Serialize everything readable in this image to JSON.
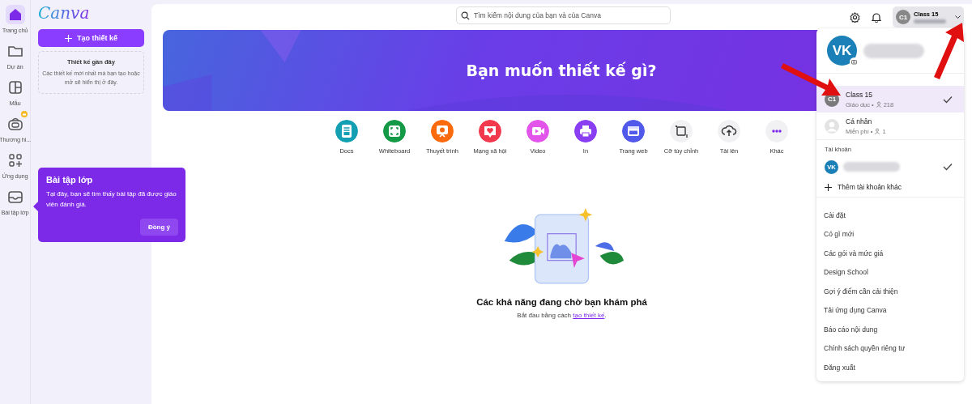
{
  "logo": "Canva",
  "rail": [
    {
      "label": "Trang chủ",
      "kind": "home",
      "selected": true,
      "badge": false
    },
    {
      "label": "Dự án",
      "kind": "folder",
      "selected": false,
      "badge": false
    },
    {
      "label": "Mẫu",
      "kind": "template",
      "selected": false,
      "badge": false
    },
    {
      "label": "Thương hi...",
      "kind": "brand",
      "selected": false,
      "badge": true
    },
    {
      "label": "Ứng dụng",
      "kind": "apps",
      "selected": false,
      "badge": false
    },
    {
      "label": "Bài tập lớp",
      "kind": "inbox",
      "selected": false,
      "badge": false
    }
  ],
  "create_button": "Tạo thiết kế",
  "recent": {
    "title": "Thiết kế gần đây",
    "text": "Các thiết kế mới nhất mà bạn tạo hoặc mở sẽ hiển thị ở đây."
  },
  "tooltip": {
    "title": "Bài tập lớp",
    "text": "Tại đây, bạn sẽ tìm thấy bài tập đã được giáo viên đánh giá.",
    "button": "Đồng ý"
  },
  "search": {
    "placeholder": "Tìm kiếm nội dung của bạn và của Canva"
  },
  "account_chip": {
    "initials": "C1",
    "name": "Class 15"
  },
  "banner": {
    "title": "Bạn muốn thiết kế gì?"
  },
  "design_types": [
    {
      "label": "Docs",
      "kind": "docs",
      "color": "#159fb3"
    },
    {
      "label": "Whiteboard",
      "kind": "whiteboard",
      "color": "#149a47"
    },
    {
      "label": "Thuyết trình",
      "kind": "presentation",
      "color": "#fb6a0c"
    },
    {
      "label": "Mạng xã hội",
      "kind": "social",
      "color": "#f2384c"
    },
    {
      "label": "Video",
      "kind": "video",
      "color": "#e254ea"
    },
    {
      "label": "In",
      "kind": "print",
      "color": "#8a3ef2"
    },
    {
      "label": "Trang web",
      "kind": "website",
      "color": "#5159ea"
    },
    {
      "label": "Cỡ tùy chỉnh",
      "kind": "custom",
      "color": "#f1f1f4"
    },
    {
      "label": "Tải lên",
      "kind": "upload",
      "color": "#f1f1f4"
    },
    {
      "label": "Khác",
      "kind": "more",
      "color": "#f1f1f4"
    }
  ],
  "empty_state": {
    "title": "Các khả năng đang chờ bạn khám phá",
    "text": "Bắt đầu bằng cách ",
    "link": "tạo thiết kế",
    "after": "."
  },
  "account_menu": {
    "profile_initials": "VK",
    "workspaces": [
      {
        "kind": "initials",
        "initials": "C1",
        "name": "Class 15",
        "plan": "Giáo dục",
        "separator": "•",
        "members": "218",
        "selected": true
      },
      {
        "kind": "silhouette",
        "name": "Cá nhân",
        "plan": "Miễn phí",
        "separator": "•",
        "members": "1",
        "selected": false
      }
    ],
    "accounts_label": "Tài khoản",
    "accounts": [
      {
        "initials": "VK",
        "selected": true
      }
    ],
    "add_account": "Thêm tài khoản khác",
    "items": [
      "Cài đặt",
      "Có gì mới",
      "Các gói và mức giá",
      "Design School",
      "Gợi ý điểm cần cải thiện",
      "Tải ứng dụng Canva",
      "Báo cáo nội dung",
      "Chính sách quyền riêng tư",
      "Đăng xuất"
    ]
  }
}
